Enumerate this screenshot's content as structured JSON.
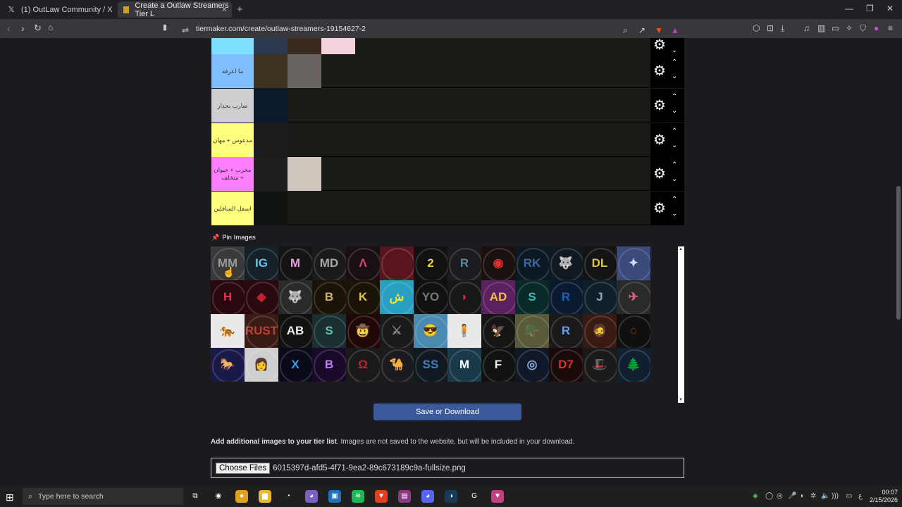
{
  "browser": {
    "tabs": [
      {
        "label": "(1) OutLaw Community / X",
        "icon": "x-logo-icon"
      },
      {
        "label": "Create a Outlaw Streamers Tier L",
        "icon": "tiermaker-icon"
      }
    ],
    "new_tab": "+",
    "url": "tiermaker.com/create/outlaw-streamers-19154627-2"
  },
  "tiers": [
    {
      "label": "",
      "color": "#7fdffe",
      "images": [
        "#2a3950",
        "#3a2a20",
        "#f4d2dc"
      ]
    },
    {
      "label": "ما اعرفه",
      "color": "#7fbfff",
      "images": [
        "#3d3320",
        "#6a6460"
      ]
    },
    {
      "label": "ضارب بجدار",
      "color": "#cfcfcf",
      "images": [
        "#0d1a2e"
      ]
    },
    {
      "label": "مدعوس + مهان",
      "color": "#ffff7f",
      "images": [
        "#1c1c1c"
      ]
    },
    {
      "label": "مخرب + حيوان + متخلف",
      "color": "#ff7fff",
      "images": [
        "#1e1e1e",
        "#cfc8bf"
      ]
    },
    {
      "label": "اسفل السافلين",
      "color": "#ffff7f",
      "images": [
        "#101410"
      ]
    }
  ],
  "tier_controls": {
    "gear": "⚙",
    "up": "⌃",
    "down": "⌄"
  },
  "pin_images_label": "Pin Images",
  "pool_images": [
    {
      "glyph": "MM",
      "bg": "#3a3a3a",
      "fg": "#999"
    },
    {
      "glyph": "IG",
      "bg": "#162028",
      "fg": "#5cc8f0"
    },
    {
      "glyph": "M",
      "bg": "#141414",
      "fg": "#e8a0e0"
    },
    {
      "glyph": "MD",
      "bg": "#1a1a1a",
      "fg": "#aaa"
    },
    {
      "glyph": "Λ",
      "bg": "#1a1014",
      "fg": "#e04070"
    },
    {
      "glyph": "",
      "bg": "#5a1420",
      "fg": "#fff"
    },
    {
      "glyph": "2",
      "bg": "#111",
      "fg": "#f0d040"
    },
    {
      "glyph": "R",
      "bg": "#1b1b20",
      "fg": "#5a8aa0"
    },
    {
      "glyph": "◉",
      "bg": "#1a1010",
      "fg": "#e03030"
    },
    {
      "glyph": "RK",
      "bg": "#0c1824",
      "fg": "#3a6aa0"
    },
    {
      "glyph": "🐺",
      "bg": "#101820",
      "fg": "#888"
    },
    {
      "glyph": "DL",
      "bg": "#141414",
      "fg": "#e0c040"
    },
    {
      "glyph": "✦",
      "bg": "#3a4a7a",
      "fg": "#cde"
    },
    {
      "glyph": "H",
      "bg": "#2a0810",
      "fg": "#e0304a"
    },
    {
      "glyph": "◆",
      "bg": "#2a0a10",
      "fg": "#c02030"
    },
    {
      "glyph": "🐺",
      "bg": "#2a2a2a",
      "fg": "#ccc"
    },
    {
      "glyph": "B",
      "bg": "#1a1408",
      "fg": "#d0b070"
    },
    {
      "glyph": "K",
      "bg": "#1a1408",
      "fg": "#e0c040"
    },
    {
      "glyph": "ش",
      "bg": "#2aa0c0",
      "fg": "#f0e040"
    },
    {
      "glyph": "YO",
      "bg": "#111",
      "fg": "#777"
    },
    {
      "glyph": "◗",
      "bg": "#181818",
      "fg": "#d03030"
    },
    {
      "glyph": "AD",
      "bg": "#5a2060",
      "fg": "#f0c040"
    },
    {
      "glyph": "S",
      "bg": "#0a2a2a",
      "fg": "#30c0c0"
    },
    {
      "glyph": "R",
      "bg": "#0a1a30",
      "fg": "#2060c0"
    },
    {
      "glyph": "J",
      "bg": "#10202a",
      "fg": "#8ab"
    },
    {
      "glyph": "✈",
      "bg": "#2a2a2a",
      "fg": "#e06080"
    },
    {
      "glyph": "🐅",
      "bg": "#e8e8e8",
      "fg": "#222"
    },
    {
      "glyph": "RUST",
      "bg": "#3a1a14",
      "fg": "#c04030"
    },
    {
      "glyph": "AB",
      "bg": "#111",
      "fg": "#eee"
    },
    {
      "glyph": "S",
      "bg": "#1a3030",
      "fg": "#60c0b0"
    },
    {
      "glyph": "🤠",
      "bg": "#200808",
      "fg": "#c03020"
    },
    {
      "glyph": "⚔",
      "bg": "#1a1a1a",
      "fg": "#888"
    },
    {
      "glyph": "😎",
      "bg": "#4a8ab0",
      "fg": "#fff"
    },
    {
      "glyph": "🧍",
      "bg": "#e8e8e8",
      "fg": "#333"
    },
    {
      "glyph": "🦅",
      "bg": "#151515",
      "fg": "#ddd"
    },
    {
      "glyph": "🪖",
      "bg": "#5a5a3a",
      "fg": "#ccc"
    },
    {
      "glyph": "R",
      "bg": "#1a1a1a",
      "fg": "#60a0f0"
    },
    {
      "glyph": "🧔",
      "bg": "#3a1a10",
      "fg": "#d08050"
    },
    {
      "glyph": "◌",
      "bg": "#101010",
      "fg": "#e05020"
    },
    {
      "glyph": "🐎",
      "bg": "#1a1a4a",
      "fg": "#e040a0"
    },
    {
      "glyph": "👩",
      "bg": "#cfcfcf",
      "fg": "#333"
    },
    {
      "glyph": "X",
      "bg": "#0a0a1a",
      "fg": "#30a0f0"
    },
    {
      "glyph": "B",
      "bg": "#1a0a2a",
      "fg": "#c080f0"
    },
    {
      "glyph": "Ω",
      "bg": "#1a1a1a",
      "fg": "#c02030"
    },
    {
      "glyph": "🐪",
      "bg": "#1b1a1f",
      "fg": "#ddd"
    },
    {
      "glyph": "SS",
      "bg": "#101820",
      "fg": "#4080c0"
    },
    {
      "glyph": "M",
      "bg": "#1a3a4a",
      "fg": "#fff"
    },
    {
      "glyph": "F",
      "bg": "#111",
      "fg": "#eee"
    },
    {
      "glyph": "◎",
      "bg": "#101828",
      "fg": "#8ab0e0"
    },
    {
      "glyph": "D7",
      "bg": "#1a0a0a",
      "fg": "#e03030"
    },
    {
      "glyph": "🎩",
      "bg": "#1a1a1a",
      "fg": "#999"
    },
    {
      "glyph": "🌲",
      "bg": "#102030",
      "fg": "#9bd"
    }
  ],
  "save_button": "Save or Download",
  "add_images": {
    "bold": "Add additional images to your tier list",
    "rest": ". Images are not saved to the website, but will be included in your download."
  },
  "file_input": {
    "button": "Choose Files",
    "filename": "6015397d-afd5-4f71-9ea2-89c673189c9a-fullsize.png"
  },
  "taskbar": {
    "search_placeholder": "Type here to search",
    "time": "00:07",
    "date": "2/15/2026",
    "apps": [
      {
        "name": "task-view-icon",
        "color": "#1f1f1f",
        "glyph": "⧉"
      },
      {
        "name": "steam-icon",
        "color": "#1f1f1f",
        "glyph": "◉"
      },
      {
        "name": "chrome-icon",
        "color": "#e0a020",
        "glyph": "●"
      },
      {
        "name": "file-explorer-icon",
        "color": "#e8b830",
        "glyph": "▆"
      },
      {
        "name": "app-icon",
        "color": "#1f1f1f",
        "glyph": "◔"
      },
      {
        "name": "discord-ptb-icon",
        "color": "#7a60c0",
        "glyph": "◕"
      },
      {
        "name": "store-icon",
        "color": "#2070c0",
        "glyph": "▣"
      },
      {
        "name": "spotify-icon",
        "color": "#1db954",
        "glyph": "≋"
      },
      {
        "name": "brave-icon",
        "color": "#e04020",
        "glyph": "▼"
      },
      {
        "name": "winrar-icon",
        "color": "#8a3a80",
        "glyph": "▤"
      },
      {
        "name": "discord-icon",
        "color": "#5865f2",
        "glyph": "◕"
      },
      {
        "name": "steam-client-icon",
        "color": "#1a3a5a",
        "glyph": "◑"
      },
      {
        "name": "geforce-icon",
        "color": "#1f1f1f",
        "glyph": "G"
      },
      {
        "name": "brave-nightly-icon",
        "color": "#c04080",
        "glyph": "▼"
      }
    ]
  }
}
